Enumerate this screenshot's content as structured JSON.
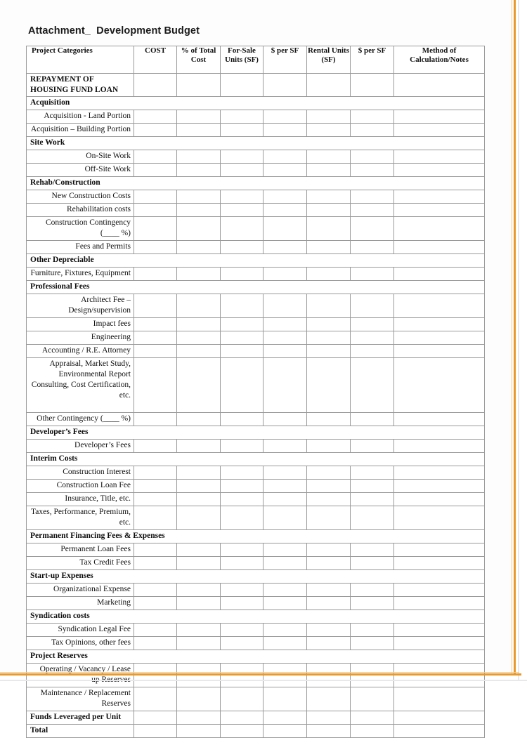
{
  "document": {
    "title": "Attachment_  Development Budget"
  },
  "table": {
    "columns": [
      "Project Categories",
      "COST",
      "% of Total Cost",
      "For-Sale Units (SF)",
      "$ per SF",
      "Rental Units (SF)",
      "$ per SF",
      "Method of Calculation/Notes"
    ],
    "rows": [
      {
        "type": "bold",
        "label": "REPAYMENT OF HOUSING FUND LOAN",
        "height": "r2"
      },
      {
        "type": "section",
        "label": "Acquisition"
      },
      {
        "type": "item",
        "label": "Acquisition - Land Portion"
      },
      {
        "type": "item",
        "label": "Acquisition – Building Portion"
      },
      {
        "type": "section",
        "label": "Site Work"
      },
      {
        "type": "item",
        "label": "On-Site Work"
      },
      {
        "type": "item",
        "label": "Off-Site Work"
      },
      {
        "type": "section",
        "label": "Rehab/Construction"
      },
      {
        "type": "item",
        "label": "New Construction Costs"
      },
      {
        "type": "item",
        "label": "Rehabilitation costs"
      },
      {
        "type": "item",
        "label": "Construction Contingency (____ %)",
        "height": "r2"
      },
      {
        "type": "item",
        "label": "Fees and Permits"
      },
      {
        "type": "section",
        "label": "Other Depreciable"
      },
      {
        "type": "item",
        "label": "Furniture, Fixtures, Equipment"
      },
      {
        "type": "section",
        "label": "Professional Fees"
      },
      {
        "type": "item",
        "label": "Architect Fee – Design/supervision",
        "height": "r2"
      },
      {
        "type": "item",
        "label": "Impact fees"
      },
      {
        "type": "item",
        "label": "Engineering"
      },
      {
        "type": "item",
        "label": "Accounting / R.E. Attorney"
      },
      {
        "type": "item",
        "label": "Appraisal, Market Study, Environmental Report Consulting, Cost Certification, etc.",
        "height": "rtall",
        "padBottom": true
      },
      {
        "type": "item",
        "label": "Other Contingency (____ %)"
      },
      {
        "type": "section",
        "label": "Developer’s Fees"
      },
      {
        "type": "item",
        "label": "Developer’s Fees"
      },
      {
        "type": "section",
        "label": "Interim Costs"
      },
      {
        "type": "item",
        "label": "Construction Interest"
      },
      {
        "type": "item",
        "label": "Construction Loan Fee"
      },
      {
        "type": "item",
        "label": "Insurance, Title, etc."
      },
      {
        "type": "item",
        "label": "Taxes, Performance, Premium, etc.",
        "height": "r2"
      },
      {
        "type": "section",
        "label": "Permanent Financing Fees & Expenses"
      },
      {
        "type": "item",
        "label": "Permanent Loan Fees"
      },
      {
        "type": "item",
        "label": "Tax Credit Fees"
      },
      {
        "type": "section",
        "label": "Start-up Expenses"
      },
      {
        "type": "item",
        "label": "Organizational Expense"
      },
      {
        "type": "item",
        "label": "Marketing"
      },
      {
        "type": "section",
        "label": "Syndication costs"
      },
      {
        "type": "item",
        "label": "Syndication Legal Fee"
      },
      {
        "type": "item",
        "label": "Tax Opinions, other fees"
      },
      {
        "type": "section",
        "label": "Project Reserves"
      },
      {
        "type": "item",
        "label": "Operating / Vacancy /  Lease up Reserves",
        "height": "r2"
      },
      {
        "type": "item",
        "label": "Maintenance / Replacement Reserves",
        "height": "r2"
      },
      {
        "type": "bold",
        "label": "Funds Leveraged per Unit"
      },
      {
        "type": "bold",
        "label": "Total"
      }
    ]
  },
  "colors": {
    "frame_accent": "#e8992c",
    "table_border": "#9a9a9a",
    "text": "#101010"
  }
}
